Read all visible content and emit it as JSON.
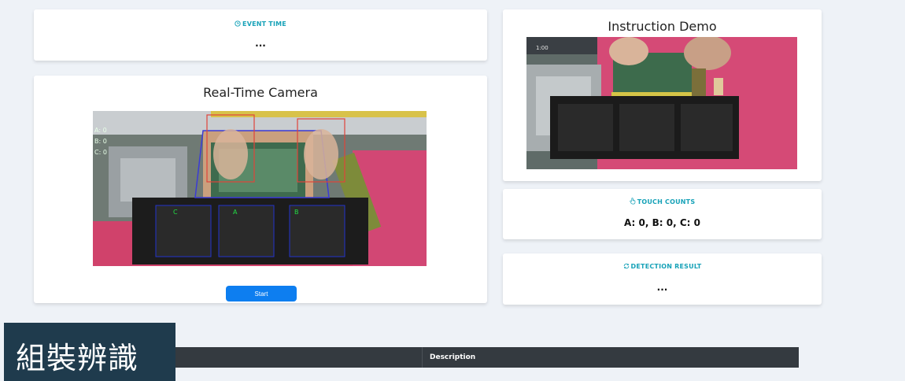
{
  "event_time": {
    "label": "EVENT TIME",
    "value": "...",
    "icon": "clock-icon"
  },
  "camera": {
    "title": "Real-Time Camera",
    "start_button": "Start",
    "hud": [
      "A: 0",
      "B: 0",
      "C: 0"
    ],
    "zones": [
      "C",
      "A",
      "B"
    ]
  },
  "demo": {
    "title": "Instruction Demo",
    "timestamp": "1:00"
  },
  "touch_counts": {
    "label": "TOUCH COUNTS",
    "value": "A: 0, B: 0, C: 0",
    "icon": "hand-pointer-icon"
  },
  "detection": {
    "label": "DETECTION RESULT",
    "value": "...",
    "icon": "refresh-icon"
  },
  "table": {
    "header": "Description"
  },
  "overlay_title": "組裝辨識",
  "colors": {
    "accent": "#17a2b8",
    "button": "#0d7ef0",
    "table_header": "#343a40",
    "overlay": "#1f3b4d",
    "background": "#eef2f7"
  }
}
